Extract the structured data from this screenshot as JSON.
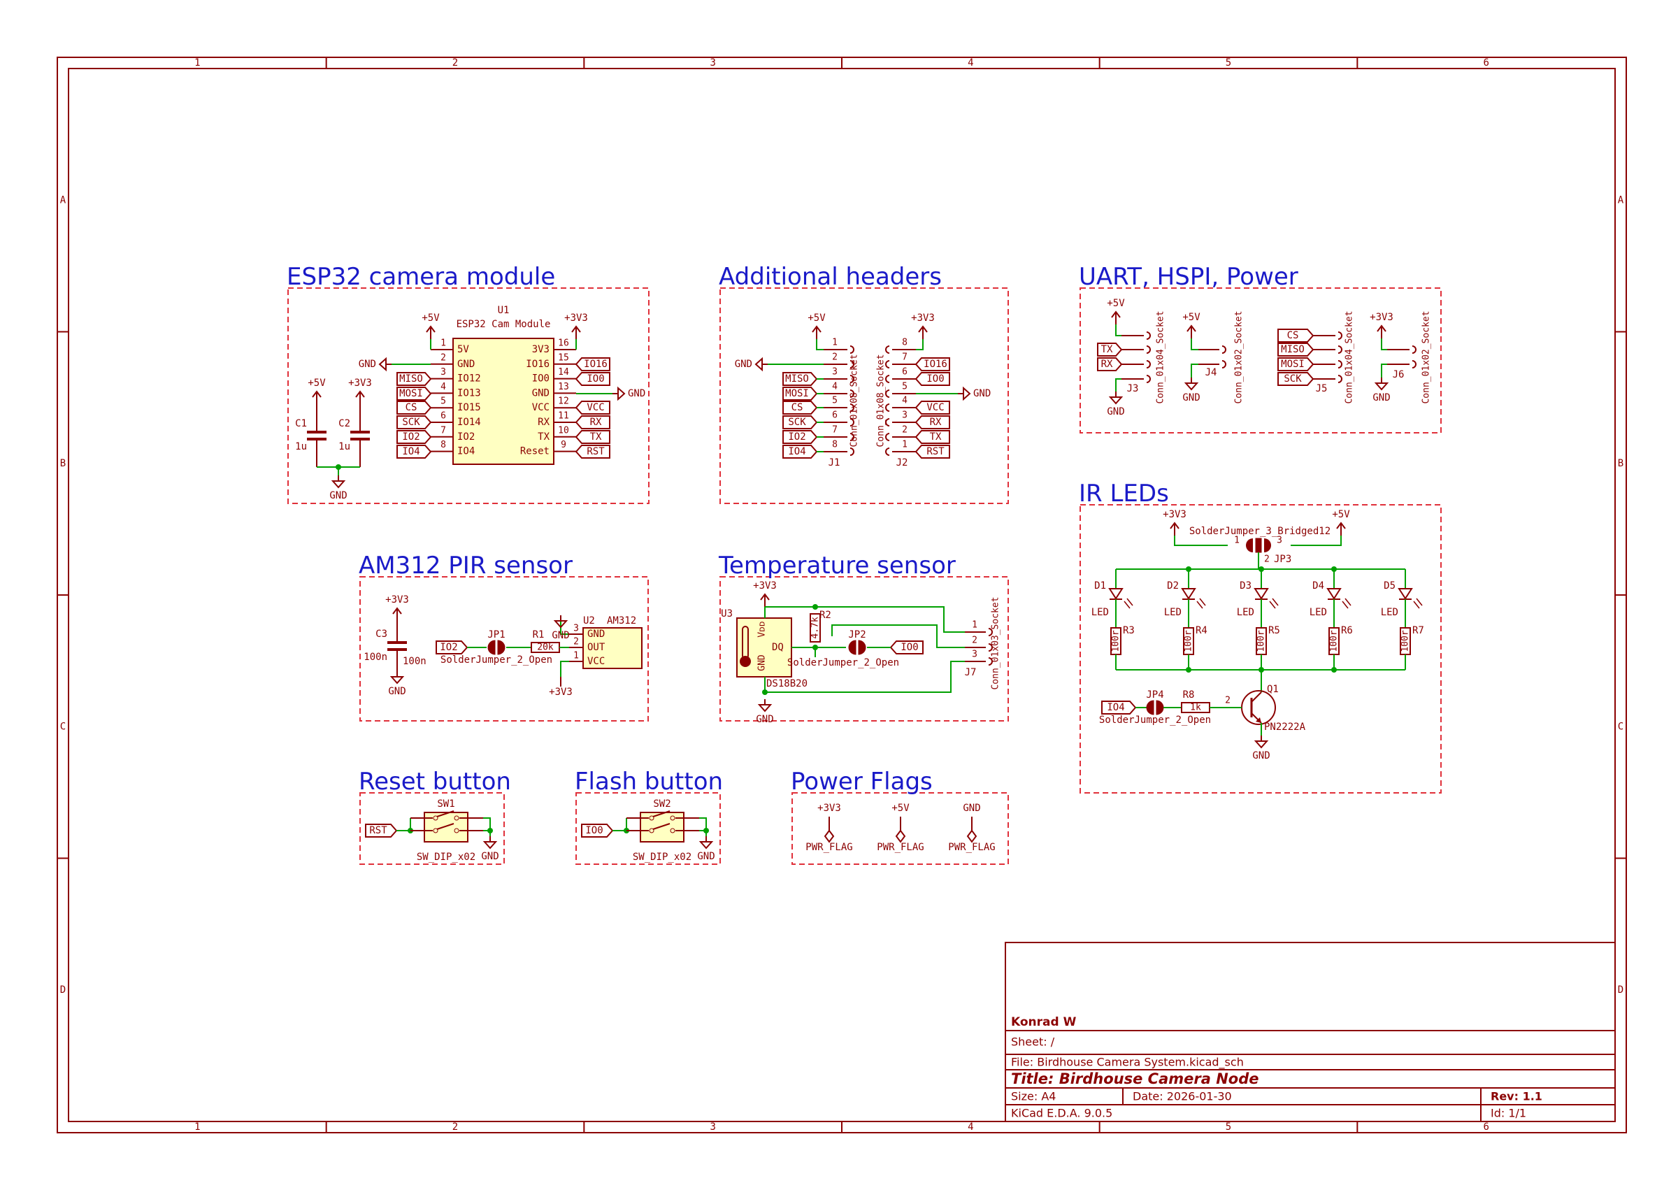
{
  "frame": {
    "col_labels": [
      "1",
      "2",
      "3",
      "4",
      "5",
      "6"
    ],
    "row_labels": [
      "A",
      "B",
      "C",
      "D"
    ]
  },
  "colors": {
    "frame": "#8b0000",
    "box": "#e0303a",
    "wire": "#00a000",
    "component": "#8b0000",
    "body_fill": "#ffffc2",
    "heading": "#1a1ac8",
    "label": "#007070"
  },
  "blocks": {
    "esp32": "ESP32 camera module",
    "headers": "Additional headers",
    "uart": "UART, HSPI, Power",
    "ir": "IR LEDs",
    "pir": "AM312 PIR sensor",
    "temp": "Temperature sensor",
    "reset": "Reset button",
    "flash": "Flash button",
    "flags": "Power Flags"
  },
  "u1": {
    "ref": "U1",
    "value": "ESP32 Cam Module",
    "left_names": [
      "5V",
      "GND",
      "IO12",
      "IO13",
      "IO15",
      "IO14",
      "IO2",
      "IO4"
    ],
    "left_nums": [
      "1",
      "2",
      "3",
      "4",
      "5",
      "6",
      "7",
      "8"
    ],
    "right_names": [
      "3V3",
      "IO16",
      "IO0",
      "GND",
      "VCC",
      "RX",
      "TX",
      "Reset"
    ],
    "right_nums": [
      "16",
      "15",
      "14",
      "13",
      "12",
      "11",
      "10",
      "9"
    ]
  },
  "esp_labels_left": [
    "MISO",
    "MOSI",
    "CS",
    "SCK",
    "IO2",
    "IO4"
  ],
  "esp_labels_right": [
    "IO16",
    "IO0",
    "VCC",
    "RX",
    "TX",
    "RST"
  ],
  "caps": {
    "c1_ref": "C1",
    "c1_val": "1u",
    "c2_ref": "C2",
    "c2_val": "1u",
    "c3_ref": "C3",
    "c3_val": "100n"
  },
  "power": {
    "p5v": "+5V",
    "p3v3": "+3V3",
    "gnd": "GND"
  },
  "j1": {
    "ref": "J1",
    "value": "Conn_01x08_Socket",
    "nums": [
      "1",
      "2",
      "3",
      "4",
      "5",
      "6",
      "7",
      "8"
    ],
    "labels": [
      "MISO",
      "MOSI",
      "CS",
      "SCK",
      "IO2",
      "IO4"
    ]
  },
  "j2": {
    "ref": "J2",
    "value": "Conn_01x08_Socket",
    "nums": [
      "8",
      "7",
      "6",
      "5",
      "4",
      "3",
      "2",
      "1"
    ],
    "labels": [
      "IO16",
      "IO0",
      "VCC",
      "RX",
      "TX",
      "RST"
    ]
  },
  "j3": {
    "ref": "J3",
    "value": "Conn_01x04_Socket",
    "labels": [
      "TX",
      "RX"
    ]
  },
  "j4": {
    "ref": "J4",
    "value": "Conn_01x02_Socket"
  },
  "j5": {
    "ref": "J5",
    "value": "Conn_01x04_Socket",
    "labels": [
      "CS",
      "MISO",
      "MOSI",
      "SCK"
    ]
  },
  "j6": {
    "ref": "J6",
    "value": "Conn_01x02_Socket"
  },
  "ir": {
    "jp3_ref": "JP3",
    "jp3_val": "SolderJumper_3_Bridged12",
    "leds": [
      "D1",
      "D2",
      "D3",
      "D4",
      "D5"
    ],
    "led_val": "LED",
    "res": [
      "R3",
      "R4",
      "R5",
      "R6",
      "R7"
    ],
    "res_val": "100r",
    "jp4_ref": "JP4",
    "jp4_val": "SolderJumper_2_Open",
    "jp4_label": "IO4",
    "r8_ref": "R8",
    "r8_val": "1k",
    "q1_ref": "Q1",
    "q1_val": "PN2222A"
  },
  "pir": {
    "jp1_ref": "JP1",
    "jp1_val": "SolderJumper_2_Open",
    "label": "IO2",
    "r1_ref": "R1",
    "r1_val": "20k",
    "u2_ref": "U2",
    "u2_val": "AM312",
    "pins": [
      "GND",
      "OUT",
      "VCC"
    ],
    "pin_nums": [
      "3",
      "2",
      "1"
    ]
  },
  "temp": {
    "u3_ref": "U3",
    "u3_val": "DS18B20",
    "vdd": "Vᴅᴅ",
    "gnd": "GND",
    "dq": "DQ",
    "r2_ref": "R2",
    "r2_val": "4.7k",
    "jp2_ref": "JP2",
    "jp2_val": "SolderJumper_2_Open",
    "label": "IO0",
    "j7_ref": "J7",
    "j7_val": "Conn_01x03_Socket"
  },
  "reset": {
    "ref": "SW1",
    "value": "SW_DIP_x02",
    "label": "RST"
  },
  "flash": {
    "ref": "SW2",
    "value": "SW_DIP_x02",
    "label": "IO0"
  },
  "flags": {
    "label": "PWR_FLAG",
    "nets": [
      "+3V3",
      "+5V",
      "GND"
    ]
  },
  "title_block": {
    "company": "Konrad W",
    "sheet": "Sheet: /",
    "file": "File: Birdhouse Camera System.kicad_sch",
    "title": "Title: Birdhouse Camera Node",
    "size": "Size: A4",
    "date": "Date: 2026-01-30",
    "tool": "KiCad E.D.A. 9.0.5",
    "rev": "Rev: 1.1",
    "id": "Id: 1/1"
  }
}
